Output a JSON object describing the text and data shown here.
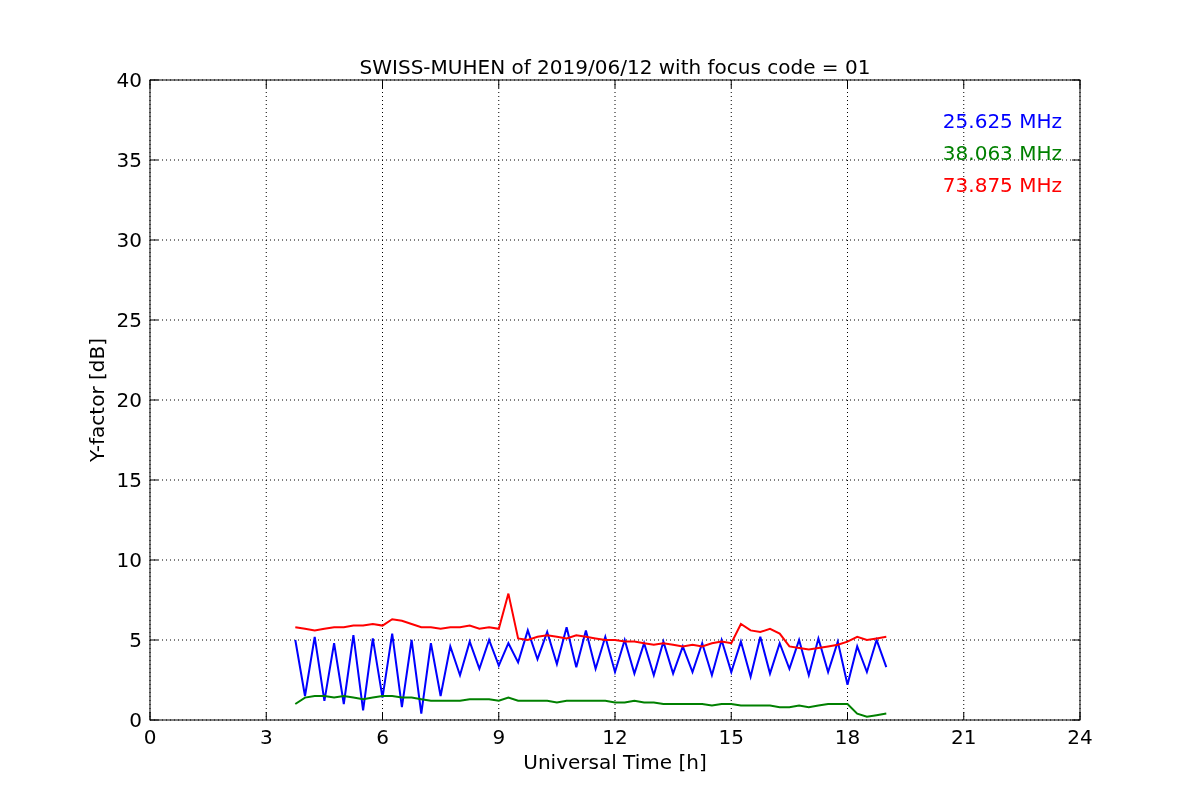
{
  "figure": {
    "chart_data": {
      "type": "line",
      "title": "SWISS-MUHEN of 2019/06/12 with focus code = 01",
      "xlabel": "Universal Time [h]",
      "ylabel": "Y-factor [dB]",
      "x": [
        3.75,
        4,
        4.25,
        4.5,
        4.75,
        5,
        5.25,
        5.5,
        5.75,
        6,
        6.25,
        6.5,
        6.75,
        7,
        7.25,
        7.5,
        7.75,
        8,
        8.25,
        8.5,
        8.75,
        9,
        9.25,
        9.5,
        9.75,
        10,
        10.25,
        10.5,
        10.75,
        11,
        11.25,
        11.5,
        11.75,
        12,
        12.25,
        12.5,
        12.75,
        13,
        13.25,
        13.5,
        13.75,
        14,
        14.25,
        14.5,
        14.75,
        15,
        15.25,
        15.5,
        15.75,
        16,
        16.25,
        16.5,
        16.75,
        17,
        17.25,
        17.5,
        17.75,
        18,
        18.25,
        18.5,
        18.75,
        19
      ],
      "series": [
        {
          "name": "25.625 MHz",
          "color": "#0000ff",
          "values": [
            5.0,
            1.5,
            5.2,
            1.2,
            4.8,
            1.0,
            5.3,
            0.6,
            5.1,
            1.4,
            5.4,
            0.8,
            5.0,
            0.4,
            4.8,
            1.5,
            4.6,
            2.8,
            4.9,
            3.2,
            5.0,
            3.4,
            4.8,
            3.6,
            5.6,
            3.8,
            5.5,
            3.5,
            5.8,
            3.3,
            5.6,
            3.2,
            5.2,
            3.0,
            5.0,
            2.9,
            4.8,
            2.8,
            4.9,
            2.9,
            4.6,
            3.0,
            4.8,
            2.8,
            5.0,
            3.0,
            4.9,
            2.7,
            5.2,
            2.9,
            4.8,
            3.2,
            5.0,
            2.8,
            5.1,
            3.0,
            4.9,
            2.2,
            4.6,
            3.0,
            5.0,
            3.3
          ]
        },
        {
          "name": "38.063 MHz",
          "color": "#008000",
          "values": [
            1.0,
            1.4,
            1.5,
            1.5,
            1.4,
            1.5,
            1.4,
            1.3,
            1.4,
            1.5,
            1.5,
            1.4,
            1.4,
            1.3,
            1.2,
            1.2,
            1.2,
            1.2,
            1.3,
            1.3,
            1.3,
            1.2,
            1.4,
            1.2,
            1.2,
            1.2,
            1.2,
            1.1,
            1.2,
            1.2,
            1.2,
            1.2,
            1.2,
            1.1,
            1.1,
            1.2,
            1.1,
            1.1,
            1.0,
            1.0,
            1.0,
            1.0,
            1.0,
            0.9,
            1.0,
            1.0,
            0.9,
            0.9,
            0.9,
            0.9,
            0.8,
            0.8,
            0.9,
            0.8,
            0.9,
            1.0,
            1.0,
            1.0,
            0.4,
            0.2,
            0.3,
            0.4
          ]
        },
        {
          "name": "73.875 MHz",
          "color": "#ff0000",
          "values": [
            5.8,
            5.7,
            5.6,
            5.7,
            5.8,
            5.8,
            5.9,
            5.9,
            6.0,
            5.9,
            6.3,
            6.2,
            6.0,
            5.8,
            5.8,
            5.7,
            5.8,
            5.8,
            5.9,
            5.7,
            5.8,
            5.7,
            7.9,
            5.1,
            5.0,
            5.2,
            5.3,
            5.2,
            5.1,
            5.3,
            5.2,
            5.1,
            5.0,
            5.0,
            4.9,
            4.9,
            4.8,
            4.7,
            4.8,
            4.7,
            4.6,
            4.7,
            4.6,
            4.8,
            4.9,
            4.8,
            6.0,
            5.6,
            5.5,
            5.7,
            5.4,
            4.6,
            4.5,
            4.4,
            4.5,
            4.6,
            4.7,
            4.9,
            5.2,
            5.0,
            5.1,
            5.2
          ]
        }
      ],
      "grid": true,
      "xlim": [
        0,
        24
      ],
      "ylim": [
        0,
        40
      ],
      "xticks": [
        0,
        3,
        6,
        9,
        12,
        15,
        18,
        21,
        24
      ],
      "yticks": [
        0,
        5,
        10,
        15,
        20,
        25,
        30,
        35,
        40
      ]
    }
  }
}
